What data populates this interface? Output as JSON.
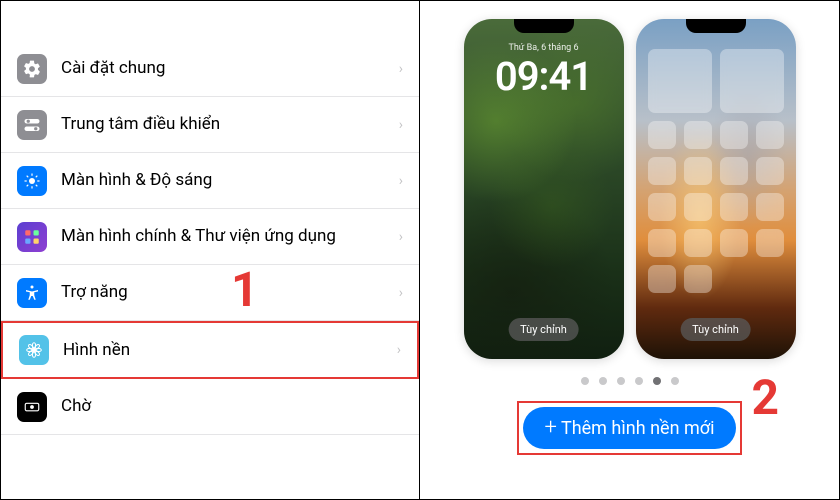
{
  "settings": {
    "items": [
      {
        "label": "Cài đặt chung",
        "icon": "gear",
        "bg": "#8e8e93"
      },
      {
        "label": "Trung tâm điều khiển",
        "icon": "toggles",
        "bg": "#8e8e93"
      },
      {
        "label": "Màn hình & Độ sáng",
        "icon": "sun",
        "bg": "#007aff"
      },
      {
        "label": "Màn hình chính & Thư viện ứng dụng",
        "icon": "grid",
        "bg": "#4b3fb2"
      },
      {
        "label": "Trợ năng",
        "icon": "accessibility",
        "bg": "#007aff"
      },
      {
        "label": "Hình nền",
        "icon": "flower",
        "bg": "#53c2e8"
      },
      {
        "label": "Chờ",
        "icon": "standby",
        "bg": "#000000"
      }
    ]
  },
  "annotations": {
    "step1": "1",
    "step2": "2"
  },
  "wallpaper": {
    "lockscreen": {
      "date": "Thứ Ba, 6 tháng 6",
      "time": "09:41",
      "customize_label": "Tùy chỉnh"
    },
    "homescreen": {
      "customize_label": "Tùy chỉnh"
    },
    "page_indicator": {
      "count": 6,
      "active": 4
    },
    "add_button": "Thêm hình nền mới"
  }
}
